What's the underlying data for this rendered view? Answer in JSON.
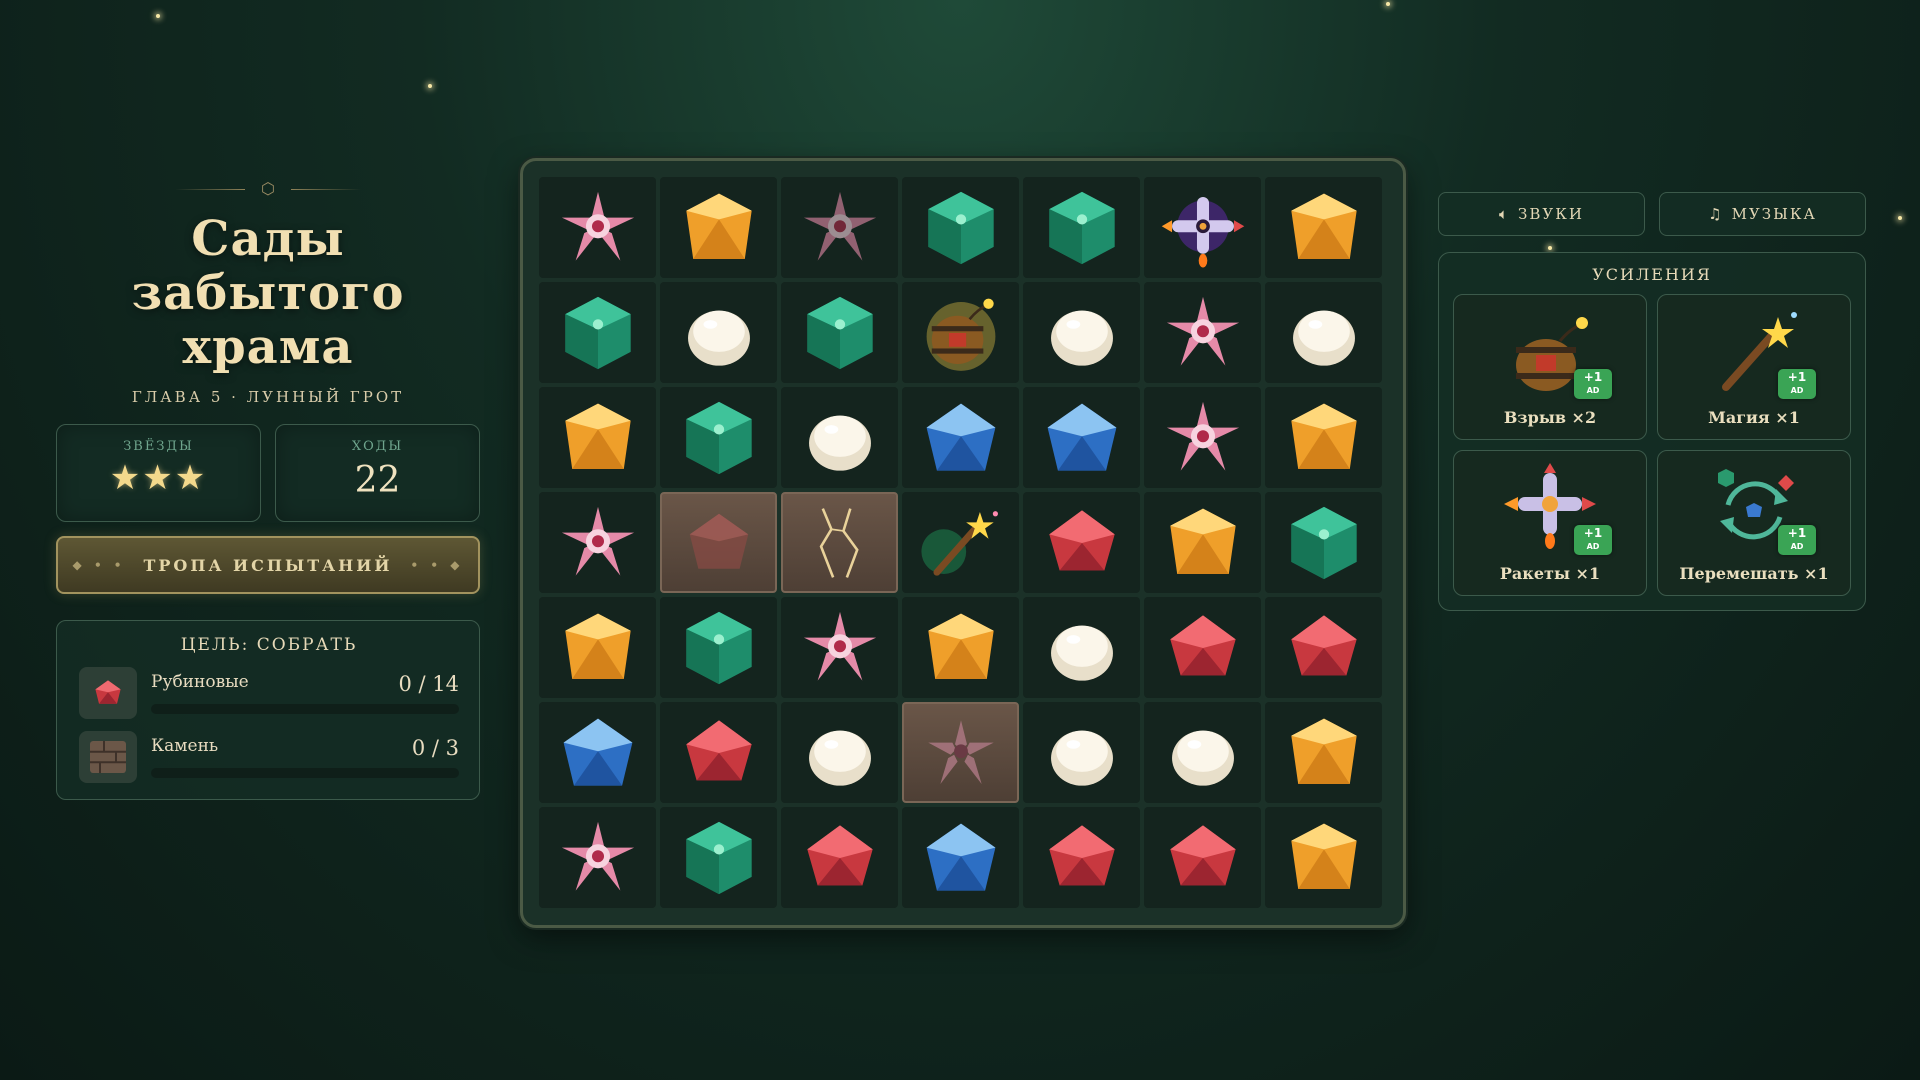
{
  "level": {
    "title_line1": "Сады забытого",
    "title_line2": "храма",
    "subtitle": "ГЛАВА 5 · ЛУННЫЙ ГРОТ"
  },
  "stats": {
    "stars_label": "ЗВЁЗДЫ",
    "stars": "★★★",
    "stars_count": 3,
    "moves_label": "ХОДЫ",
    "moves": "22"
  },
  "trail_button": "ТРОПА ИСПЫТАНИЙ",
  "goal": {
    "heading": "ЦЕЛЬ: СОБРАТЬ",
    "items": [
      {
        "label": "Рубиновые",
        "count": "0 / 14",
        "icon": "ruby-icon",
        "progress": 0
      },
      {
        "label": "Камень",
        "count": "0 / 3",
        "icon": "stone-icon",
        "progress": 0
      }
    ]
  },
  "toggles": {
    "sound_label": "ЗВУКИ",
    "music_label": "МУЗЫКА"
  },
  "boosts": {
    "heading": "УСИЛЕНИЯ",
    "ad_badge": "+1",
    "ad_sub": "AD",
    "items": [
      {
        "label": "Взрыв ×2",
        "icon": "barrel-bomb-icon"
      },
      {
        "label": "Магия ×1",
        "icon": "magic-wand-icon"
      },
      {
        "label": "Ракеты ×1",
        "icon": "rocket-icon"
      },
      {
        "label": "Перемешать ×1",
        "icon": "shuffle-icon"
      }
    ]
  },
  "board": {
    "rows": [
      [
        "flower",
        "topaz",
        "flower-dim",
        "emerald",
        "emerald",
        "rocket",
        "topaz"
      ],
      [
        "emerald",
        "pearl",
        "emerald-glow",
        "barrel",
        "pearl",
        "flower",
        "pearl"
      ],
      [
        "topaz",
        "emerald",
        "pearl",
        "sapphire",
        "sapphire",
        "flower",
        "topaz"
      ],
      [
        "flower",
        "stone-ruby",
        "stone-cracked",
        "wand",
        "ruby",
        "topaz",
        "emerald"
      ],
      [
        "topaz",
        "emerald",
        "flower",
        "topaz",
        "pearl",
        "ruby",
        "ruby"
      ],
      [
        "sapphire",
        "ruby",
        "pearl",
        "stone-flower",
        "pearl",
        "pearl",
        "topaz"
      ],
      [
        "flower",
        "emerald",
        "ruby",
        "sapphire",
        "ruby",
        "ruby",
        "topaz"
      ]
    ]
  },
  "colors": {
    "background": "#122b22",
    "accent_gold": "#f1dfb2",
    "panel": "#142d24",
    "ad_green": "#3aa455"
  }
}
